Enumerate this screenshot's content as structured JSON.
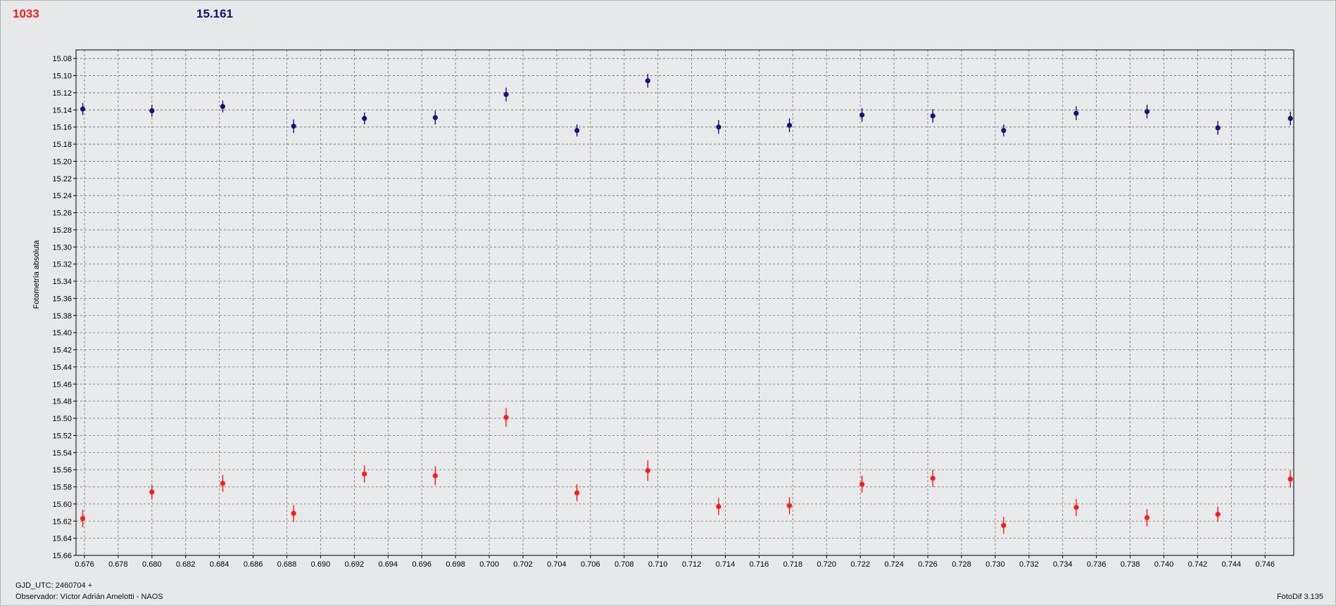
{
  "header": {
    "left_value": "1033",
    "left_color": "#ff1a1a",
    "right_value": "15.161",
    "right_color": "#141478"
  },
  "footer": {
    "gjd_label": "GJD_UTC: 2460704 +",
    "observer": "Observador: Víctor Adrián Amelotti - NAOS",
    "software": "FotoDif 3.135"
  },
  "chart_data": {
    "type": "scatter",
    "ylabel": "Fotometría absoluta",
    "xlabel": "",
    "xlim": [
      0.6755,
      0.7477
    ],
    "ylim": [
      15.07,
      15.66
    ],
    "y_inverted": true,
    "grid": true,
    "x_ticks": [
      0.676,
      0.678,
      0.68,
      0.682,
      0.684,
      0.686,
      0.688,
      0.69,
      0.692,
      0.694,
      0.696,
      0.698,
      0.7,
      0.702,
      0.704,
      0.706,
      0.708,
      0.71,
      0.712,
      0.714,
      0.716,
      0.718,
      0.72,
      0.722,
      0.724,
      0.726,
      0.728,
      0.73,
      0.732,
      0.734,
      0.736,
      0.738,
      0.74,
      0.742,
      0.744,
      0.746
    ],
    "y_ticks": [
      15.08,
      15.1,
      15.12,
      15.14,
      15.16,
      15.18,
      15.2,
      15.22,
      15.24,
      15.26,
      15.28,
      15.3,
      15.32,
      15.34,
      15.36,
      15.38,
      15.4,
      15.42,
      15.44,
      15.46,
      15.48,
      15.5,
      15.52,
      15.54,
      15.56,
      15.58,
      15.6,
      15.62,
      15.64,
      15.66
    ],
    "series": [
      {
        "color": "#141478",
        "x": [
          0.6759,
          0.68,
          0.6842,
          0.6884,
          0.6926,
          0.6968,
          0.701,
          0.7052,
          0.7094,
          0.7136,
          0.7178,
          0.7221,
          0.7263,
          0.7305,
          0.7348,
          0.739,
          0.7432,
          0.7475
        ],
        "y": [
          15.139,
          15.141,
          15.136,
          15.159,
          15.15,
          15.149,
          15.122,
          15.164,
          15.106,
          15.16,
          15.158,
          15.146,
          15.147,
          15.164,
          15.144,
          15.142,
          15.161,
          15.15
        ],
        "err": [
          0.007,
          0.007,
          0.007,
          0.008,
          0.007,
          0.008,
          0.008,
          0.007,
          0.008,
          0.008,
          0.008,
          0.008,
          0.008,
          0.007,
          0.008,
          0.008,
          0.008,
          0.008
        ]
      },
      {
        "color": "#ff1a1a",
        "x": [
          0.6759,
          0.68,
          0.6842,
          0.6884,
          0.6926,
          0.6968,
          0.701,
          0.7052,
          0.7094,
          0.7136,
          0.7178,
          0.7221,
          0.7263,
          0.7305,
          0.7348,
          0.739,
          0.7432,
          0.7475
        ],
        "y": [
          15.617,
          15.586,
          15.576,
          15.611,
          15.565,
          15.567,
          15.499,
          15.587,
          15.561,
          15.603,
          15.602,
          15.577,
          15.57,
          15.625,
          15.604,
          15.616,
          15.612,
          15.571
        ],
        "err": [
          0.01,
          0.009,
          0.01,
          0.01,
          0.01,
          0.011,
          0.011,
          0.01,
          0.012,
          0.01,
          0.01,
          0.01,
          0.01,
          0.01,
          0.01,
          0.01,
          0.009,
          0.01
        ]
      }
    ]
  }
}
